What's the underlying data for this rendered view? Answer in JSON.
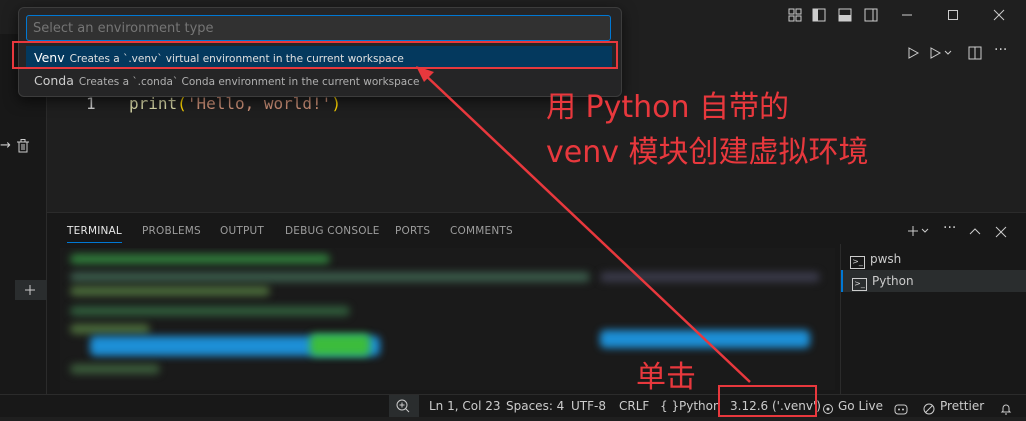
{
  "quick_pick": {
    "placeholder": "Select an environment type",
    "items": [
      {
        "label": "Venv",
        "description": "Creates a `.venv` virtual environment in the current workspace"
      },
      {
        "label": "Conda",
        "description": "Creates a `.conda` Conda environment in the current workspace"
      }
    ]
  },
  "editor": {
    "line_number": "1",
    "code": {
      "fn": "print",
      "open": "(",
      "str": "'Hello, world!'",
      "close": ")"
    }
  },
  "panel": {
    "tabs": [
      "TERMINAL",
      "PROBLEMS",
      "OUTPUT",
      "DEBUG CONSOLE",
      "PORTS",
      "COMMENTS"
    ],
    "terminals": [
      "pwsh",
      "Python"
    ]
  },
  "status_bar": {
    "position": "Ln 1, Col 23",
    "spaces": "Spaces: 4",
    "encoding": "UTF-8",
    "eol": "CRLF",
    "language_braces": "{ }",
    "language": "Python",
    "interpreter": "3.12.6 ('.venv')",
    "go_live": "Go Live",
    "prettier": "Prettier"
  },
  "annotations": {
    "venv_line1": "用 Python 自带的",
    "venv_line2": "venv 模块创建虚拟环境",
    "click": "单击"
  },
  "colors": {
    "accent": "#0078d4",
    "annotation_red": "#e8383d",
    "selection": "#04395e"
  }
}
